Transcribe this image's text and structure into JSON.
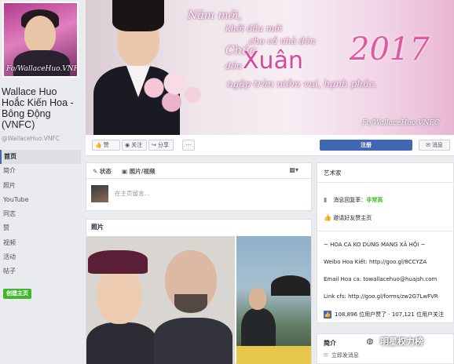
{
  "sidebar": {
    "profile_signature": "Fo/WallaceHuo.VNFC",
    "page_name": "Wallace Huo Hoắc Kiến Hoa - Bông Động (VNFC)",
    "handle": "@WallaceHuo.VNFC",
    "nav": [
      "首页",
      "简介",
      "照片",
      "YouTube",
      "同志",
      "赞",
      "视频",
      "活动",
      "帖子"
    ],
    "active_nav": "首页",
    "create_page_label": "创建主页"
  },
  "cover": {
    "line1": "Năm mới,",
    "line2": "khởi đầu mới",
    "line3": "cho cả nhà đón",
    "chuc": "Chúc",
    "don": "đón",
    "xuan": "Xuân",
    "year": "2017",
    "line4": "ngập tràn niềm vui, hạnh phúc.",
    "signature": "Fo/WallaceHuo.VNFC"
  },
  "action_bar": {
    "like_label": "赞",
    "follow_label": "关注",
    "share_label": "分享",
    "more_label": "···",
    "register_label": "注册",
    "message_label": "消息"
  },
  "composer": {
    "status_tab": "状态",
    "photo_tab": "照片/视频",
    "placeholder": "在主页留言..."
  },
  "photos": {
    "title": "照片"
  },
  "about": {
    "category": "艺术家",
    "response_label": "消息回复率：",
    "response_value": "非常高",
    "invite_label": "邀请好友赞主页",
    "bio_lines": [
      "~ HOA CA KO DÙNG MANG XÃ HỘI ~",
      "Weibo Hoa Kiết: http://goo.gl/8CCYZA",
      "Email Hoa ca: towallacehuo@huajsh.com",
      "Link cfs: http://goo.gl/forms/zw2G7LwFVR"
    ],
    "stats": "108,896 位用户赞了 · 107,121 位用户关注"
  },
  "intro": {
    "title": "简介",
    "send_message": "立即发消息"
  },
  "watermark": {
    "text": "明星权力榜"
  },
  "colors": {
    "brand_blue": "#4267b2",
    "green": "#42b72a",
    "background": "#e9ebee"
  }
}
